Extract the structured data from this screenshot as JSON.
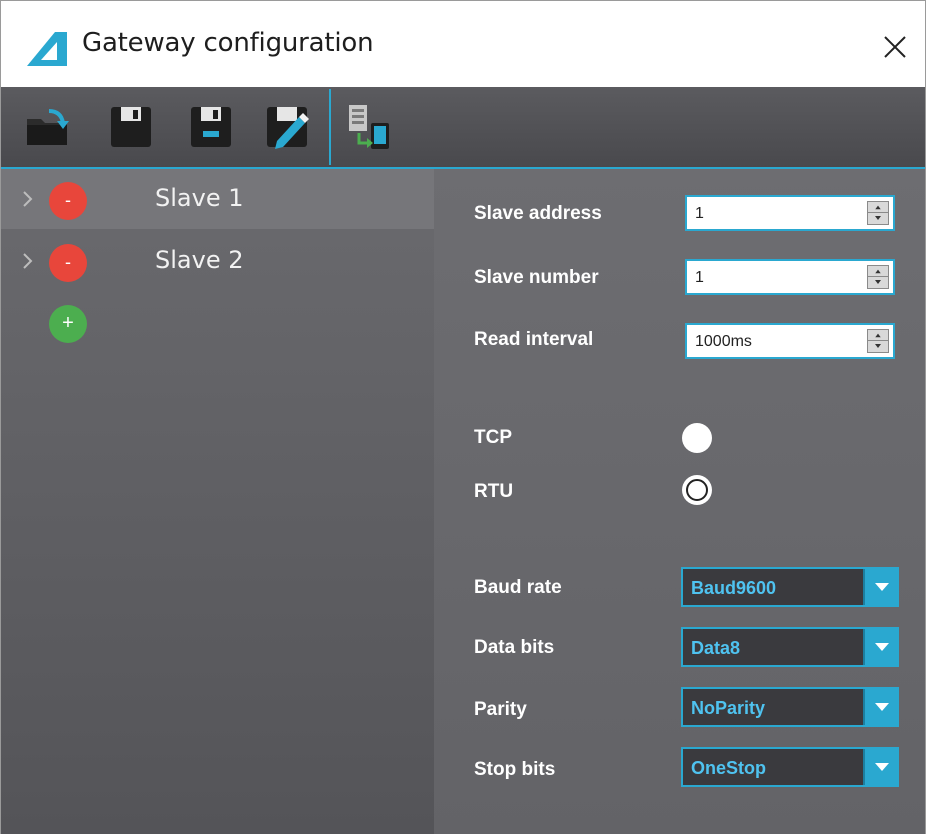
{
  "window": {
    "title": "Gateway configuration"
  },
  "toolbar": {
    "buttons": [
      {
        "icon": "open-folder-icon"
      },
      {
        "icon": "save-icon"
      },
      {
        "icon": "save-as-icon"
      },
      {
        "icon": "edit-save-icon"
      },
      {
        "icon": "transfer-to-device-icon"
      }
    ]
  },
  "slaves": [
    {
      "label": "Slave 1",
      "remove_symbol": "-"
    },
    {
      "label": "Slave 2",
      "remove_symbol": "-"
    }
  ],
  "add_symbol": "+",
  "settings": {
    "slave_address": {
      "label": "Slave address",
      "value": "1"
    },
    "slave_number": {
      "label": "Slave number",
      "value": "1"
    },
    "read_interval": {
      "label": "Read interval",
      "value": "1000ms"
    },
    "tcp": {
      "label": "TCP",
      "checked": false
    },
    "rtu": {
      "label": "RTU",
      "checked": true
    },
    "baud_rate": {
      "label": "Baud rate",
      "value": "Baud9600"
    },
    "data_bits": {
      "label": "Data bits",
      "value": "Data8"
    },
    "parity": {
      "label": "Parity",
      "value": "NoParity"
    },
    "stop_bits": {
      "label": "Stop bits",
      "value": "OneStop"
    }
  },
  "colors": {
    "accent": "#2aa8d0",
    "remove": "#e8463b",
    "add": "#4cae4f",
    "combo_text": "#4fc3f0"
  }
}
